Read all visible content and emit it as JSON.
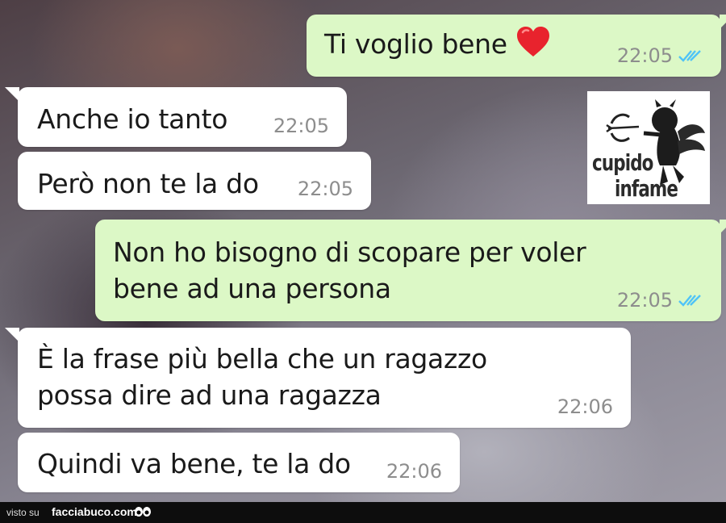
{
  "messages": [
    {
      "direction": "out",
      "text": "Ti voglio bene",
      "emoji": "red-heart",
      "time": "22:05",
      "status": "read"
    },
    {
      "direction": "in",
      "text": "Anche io tanto",
      "time": "22:05"
    },
    {
      "direction": "in",
      "text": "Però non te la do",
      "time": "22:05"
    },
    {
      "direction": "out",
      "text_lines": [
        "Non ho bisogno di scopare per voler",
        "bene ad una persona"
      ],
      "time": "22:05",
      "status": "read"
    },
    {
      "direction": "in",
      "text_lines": [
        "È la frase più bella che un ragazzo",
        "possa dire ad una ragazza"
      ],
      "time": "22:06"
    },
    {
      "direction": "in",
      "text": "Quindi va bene, te la do",
      "time": "22:06"
    }
  ],
  "watermark": {
    "line1": "cupido",
    "line2": "infame"
  },
  "footer": {
    "prefix": "visto su",
    "site": "facciabuco.com"
  },
  "colors": {
    "outgoing_bubble": "#dcf8c6",
    "incoming_bubble": "#ffffff",
    "read_ticks": "#4fc3f7",
    "timestamp": "#8d8d8d",
    "footer_bg": "#0d0d0d"
  }
}
